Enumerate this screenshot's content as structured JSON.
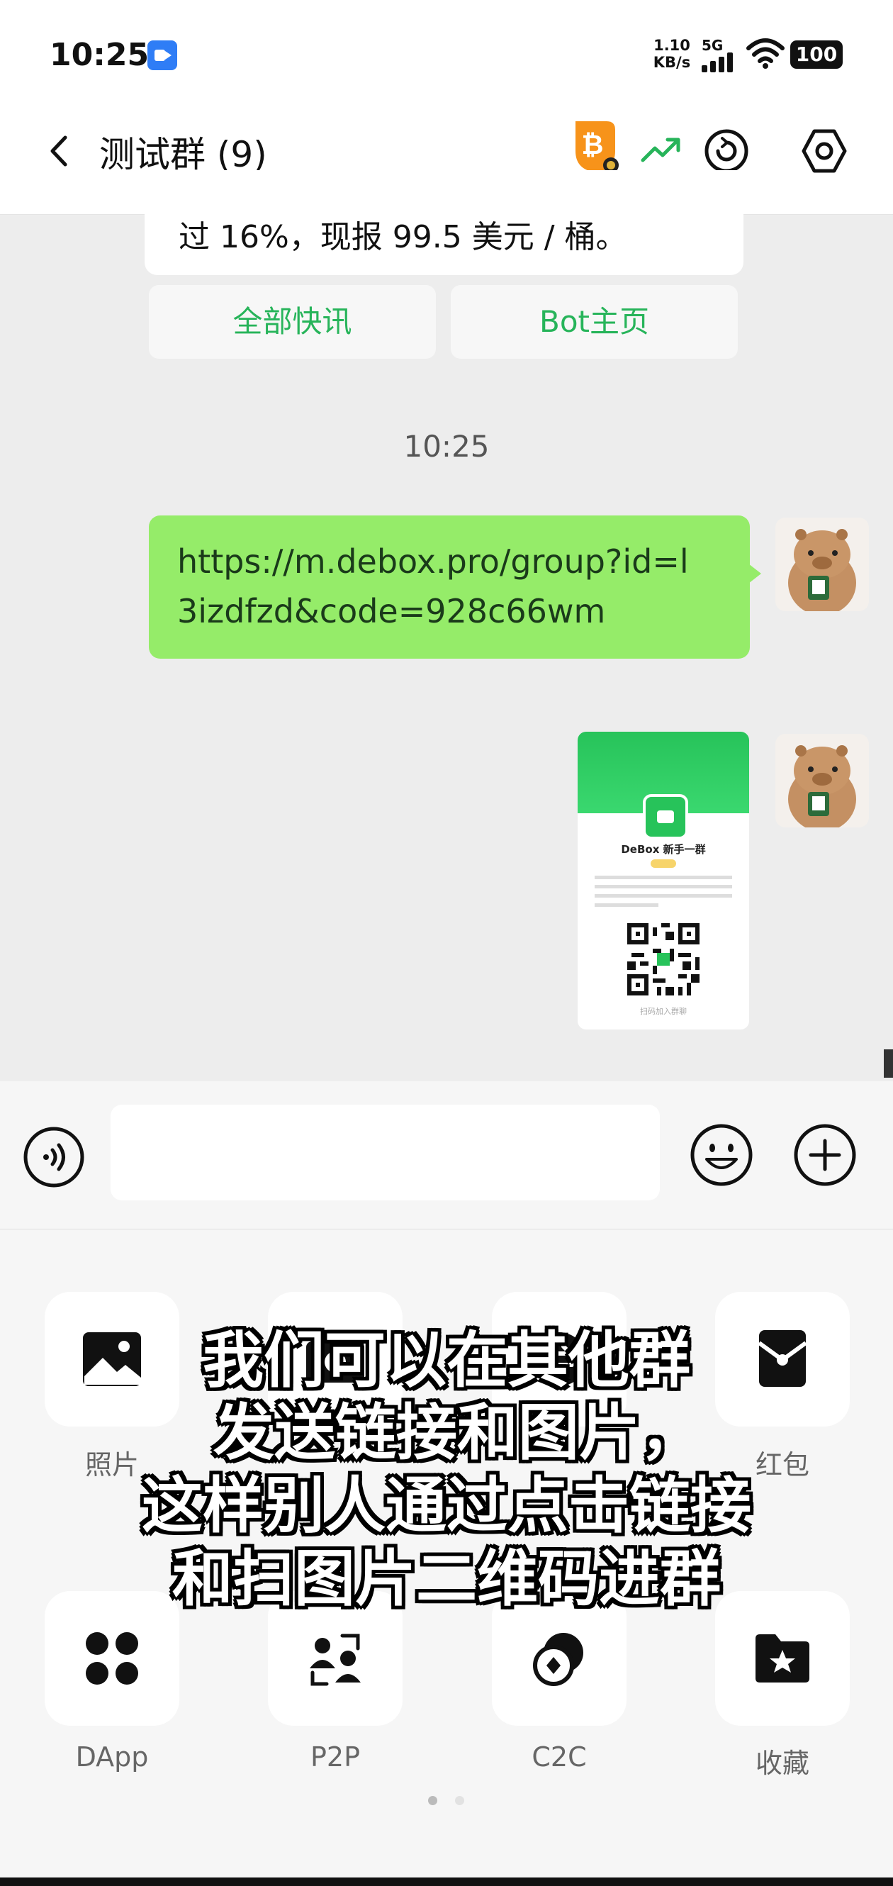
{
  "status_bar": {
    "time": "10:25",
    "net_speed_value": "1.10",
    "net_speed_unit": "KB/s",
    "network": "5G",
    "battery": "100"
  },
  "header": {
    "back_icon": "chevron-left-icon",
    "title": "测试群 (9)",
    "icons": [
      "bitcoin-icon",
      "trend-up-icon",
      "sync-icon",
      "settings-hexagon-icon"
    ]
  },
  "chat": {
    "partial_message": "过 16%，现报 99.5 美元 / 桶。",
    "quick_buttons": [
      "全部快讯",
      "Bot主页"
    ],
    "timestamp": "10:25",
    "link_message_lines": [
      "https://m.debox.pro/group?id=l",
      "3izdfzd&code=928c66wm"
    ],
    "image_card": {
      "group_name": "DeBox 新手一群",
      "footer": "扫码加入群聊"
    }
  },
  "input_bar": {
    "icons": [
      "voice-icon",
      "emoji-icon",
      "plus-icon"
    ]
  },
  "panel": {
    "row1": [
      {
        "label": "照片",
        "icon": "photo-icon"
      },
      {
        "label": "",
        "icon": "camera-icon"
      },
      {
        "label": "",
        "icon": "transfer-icon"
      },
      {
        "label": "红包",
        "icon": "red-packet-icon"
      }
    ],
    "row2": [
      {
        "label": "DApp",
        "icon": "dapp-icon"
      },
      {
        "label": "P2P",
        "icon": "p2p-icon"
      },
      {
        "label": "C2C",
        "icon": "c2c-icon"
      },
      {
        "label": "收藏",
        "icon": "favorites-icon"
      }
    ],
    "page_dots": 2
  },
  "subtitle_lines": [
    "我们可以在其他群",
    "发送链接和图片，",
    "这样别人通过点击链接",
    "和扫图片二维码进群"
  ],
  "colors": {
    "bubble": "#95ec69",
    "accent_green": "#27b45a",
    "bitcoin": "#f7931a"
  }
}
